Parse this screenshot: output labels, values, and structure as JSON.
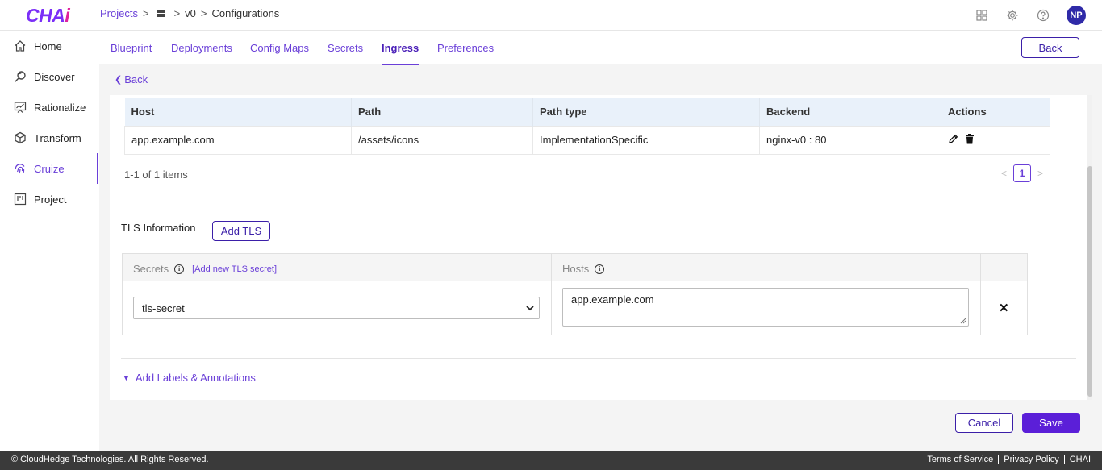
{
  "app": {
    "logo_main": "CHA",
    "logo_i": "i"
  },
  "breadcrumb": {
    "projects": "Projects",
    "version": "v0",
    "current": "Configurations"
  },
  "header": {
    "avatar_initials": "NP"
  },
  "sidebar": {
    "items": [
      {
        "label": "Home",
        "icon": "home-icon"
      },
      {
        "label": "Discover",
        "icon": "search-icon"
      },
      {
        "label": "Rationalize",
        "icon": "chart-board-icon"
      },
      {
        "label": "Transform",
        "icon": "cube-icon"
      },
      {
        "label": "Cruize",
        "icon": "fingerprint-icon",
        "active": true
      },
      {
        "label": "Project",
        "icon": "kanban-icon"
      }
    ]
  },
  "tabs": [
    {
      "label": "Blueprint"
    },
    {
      "label": "Deployments"
    },
    {
      "label": "Config Maps"
    },
    {
      "label": "Secrets"
    },
    {
      "label": "Ingress",
      "active": true
    },
    {
      "label": "Preferences"
    }
  ],
  "buttons": {
    "back_top": "Back",
    "back_link": "Back",
    "add_tls": "Add TLS",
    "cancel": "Cancel",
    "save": "Save"
  },
  "ingress_table": {
    "headers": [
      "Host",
      "Path",
      "Path type",
      "Backend",
      "Actions"
    ],
    "rows": [
      {
        "host": "app.example.com",
        "path": "/assets/icons",
        "path_type": "ImplementationSpecific",
        "backend": "nginx-v0 : 80"
      }
    ],
    "count": "1-1 of 1 items",
    "page": "1"
  },
  "tls": {
    "label": "TLS Information",
    "secrets_header": "Secrets",
    "add_secret_link": "[Add new TLS secret]",
    "hosts_header": "Hosts",
    "secret_value": "tls-secret",
    "hosts_value": "app.example.com"
  },
  "labels_annotations": "Add Labels & Annotations",
  "footer": {
    "copyright": "© CloudHedge Technologies. All Rights Reserved.",
    "links": [
      "Terms of Service",
      "Privacy Policy",
      "CHAI"
    ]
  },
  "colors": {
    "accent": "#6a3fd8",
    "primary_button": "#5b1fd8",
    "avatar": "#2f2aa8",
    "footer": "#3a3a3a"
  }
}
